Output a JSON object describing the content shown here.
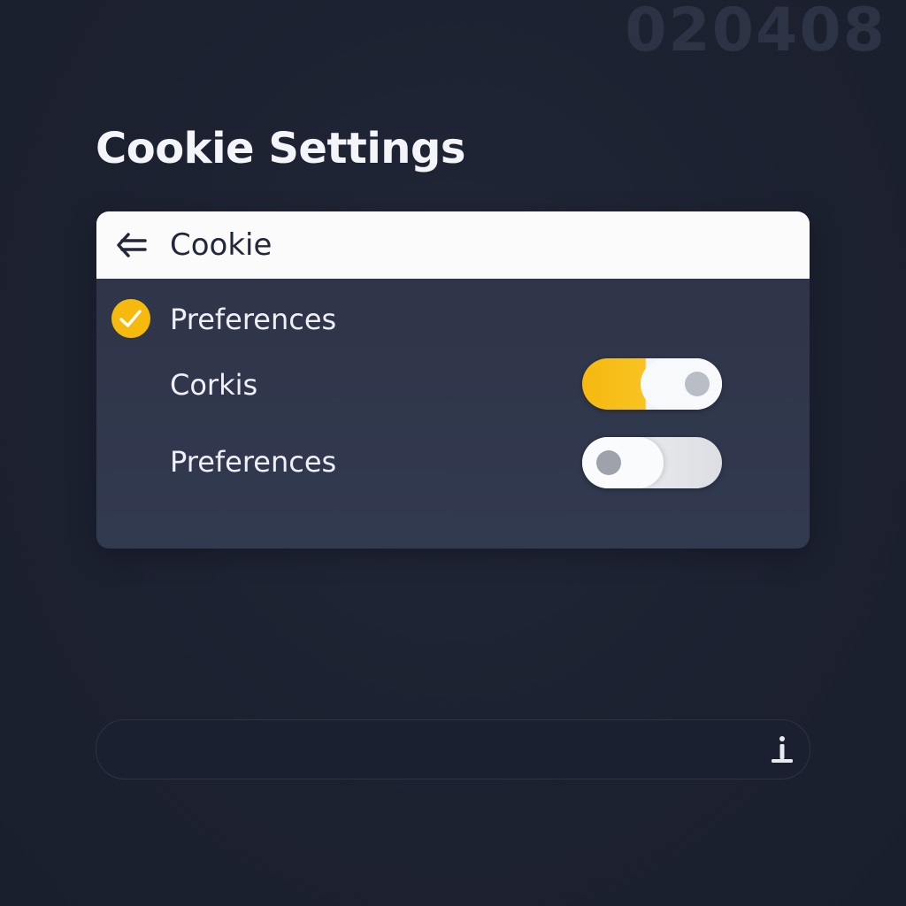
{
  "watermark": "020408",
  "page": {
    "title": "Cookie Settings"
  },
  "panel": {
    "header": {
      "label": "Cookie",
      "icon": "arrow-left-icon"
    },
    "rows": [
      {
        "label": "Preferences",
        "icon": "check-circle-icon"
      },
      {
        "label": "Corkis",
        "toggle": "on"
      },
      {
        "label": "Preferences",
        "toggle": "off"
      }
    ]
  },
  "bottom_bar": {
    "icon": "info-icon"
  },
  "colors": {
    "background": "#1d2231",
    "panel": "#2f3549",
    "accent": "#f8c01a",
    "header": "#fbfbfc",
    "text_light": "#eef0f5",
    "text_dark": "#22283a"
  }
}
